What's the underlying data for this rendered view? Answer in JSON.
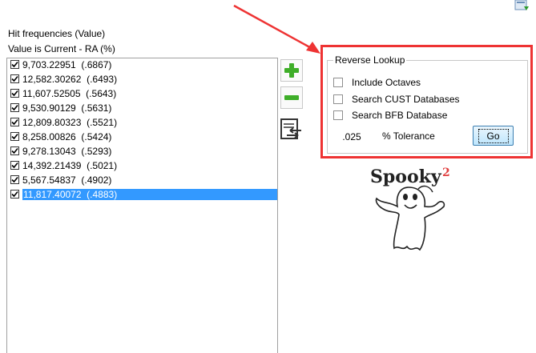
{
  "header": {
    "title": "Hit frequencies (Value)",
    "subtitle": "Value is Current - RA (%)"
  },
  "frequencies": [
    {
      "text": "9,703.22951  (.6867)",
      "checked": true,
      "selected": false
    },
    {
      "text": "12,582.30262  (.6493)",
      "checked": true,
      "selected": false
    },
    {
      "text": "11,607.52505  (.5643)",
      "checked": true,
      "selected": false
    },
    {
      "text": "9,530.90129  (.5631)",
      "checked": true,
      "selected": false
    },
    {
      "text": "12,809.80323  (.5521)",
      "checked": true,
      "selected": false
    },
    {
      "text": "8,258.00826  (.5424)",
      "checked": true,
      "selected": false
    },
    {
      "text": "9,278.13043  (.5293)",
      "checked": true,
      "selected": false
    },
    {
      "text": "14,392.21439  (.5021)",
      "checked": true,
      "selected": false
    },
    {
      "text": "5,567.54837  (.4902)",
      "checked": true,
      "selected": false
    },
    {
      "text": "11,817.40072  (.4883)",
      "checked": true,
      "selected": true
    }
  ],
  "side_buttons": {
    "add_icon": "plus-icon",
    "remove_icon": "minus-icon",
    "transfer_icon": "transfer-icon"
  },
  "reverse_lookup": {
    "title": "Reverse Lookup",
    "options": [
      {
        "label": "Include Octaves",
        "checked": false
      },
      {
        "label": "Search CUST Databases",
        "checked": false
      },
      {
        "label": "Search BFB Database",
        "checked": false
      }
    ],
    "tolerance_value": ".025",
    "tolerance_label": "% Tolerance",
    "go_label": "Go"
  },
  "logo": {
    "text": "Spooky",
    "superscript": "2"
  },
  "colors": {
    "selection": "#3399ff",
    "annotation": "#ee3333",
    "plus": "#3fae29",
    "minus": "#3fae29",
    "go_button": "#bee6fd"
  }
}
